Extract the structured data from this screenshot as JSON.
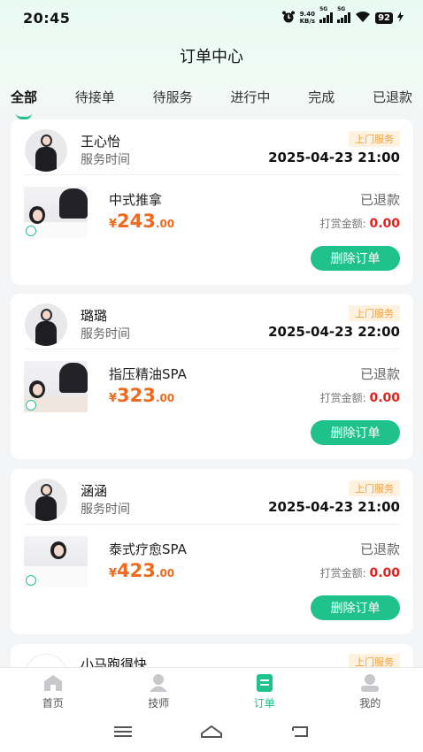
{
  "status_bar": {
    "time": "20:45",
    "net_speed_value": "9.40",
    "net_speed_unit": "KB/s",
    "signal1_label": "5G",
    "signal2_label": "5G",
    "battery": "92"
  },
  "header": {
    "title": "订单中心"
  },
  "tabs": [
    {
      "label": "全部",
      "active": true
    },
    {
      "label": "待接单",
      "active": false
    },
    {
      "label": "待服务",
      "active": false
    },
    {
      "label": "进行中",
      "active": false
    },
    {
      "label": "完成",
      "active": false
    },
    {
      "label": "已退款",
      "active": false
    }
  ],
  "orders": [
    {
      "tech_name": "王心怡",
      "service_label": "服务时间",
      "service_type": "上门服务",
      "service_time": "2025-04-23 21:00",
      "item_name": "中式推拿",
      "price_currency": "¥",
      "price_int": "243",
      "price_dec": ".00",
      "status": "已退款",
      "tip_label": "打赏金额:",
      "tip_value": "0.00",
      "action_label": "删除订单"
    },
    {
      "tech_name": "璐璐",
      "service_label": "服务时间",
      "service_type": "上门服务",
      "service_time": "2025-04-23 22:00",
      "item_name": "指压精油SPA",
      "price_currency": "¥",
      "price_int": "323",
      "price_dec": ".00",
      "status": "已退款",
      "tip_label": "打赏金额:",
      "tip_value": "0.00",
      "action_label": "删除订单"
    },
    {
      "tech_name": "涵涵",
      "service_label": "服务时间",
      "service_type": "上门服务",
      "service_time": "2025-04-23 21:00",
      "item_name": "泰式疗愈SPA",
      "price_currency": "¥",
      "price_int": "423",
      "price_dec": ".00",
      "status": "已退款",
      "tip_label": "打赏金额:",
      "tip_value": "0.00",
      "action_label": "删除订单"
    },
    {
      "tech_name": "小马跑得快",
      "service_type": "上门服务"
    }
  ],
  "bottom_nav": [
    {
      "label": "首页",
      "icon": "home-icon",
      "active": false
    },
    {
      "label": "技师",
      "icon": "technician-icon",
      "active": false
    },
    {
      "label": "订单",
      "icon": "order-icon",
      "active": true
    },
    {
      "label": "我的",
      "icon": "profile-icon",
      "active": false
    }
  ],
  "colors": {
    "accent": "#20c28b",
    "price": "#ef6a1e",
    "tip": "#e1221c",
    "badge_bg": "#fdf1df",
    "badge_text": "#f0a040"
  }
}
